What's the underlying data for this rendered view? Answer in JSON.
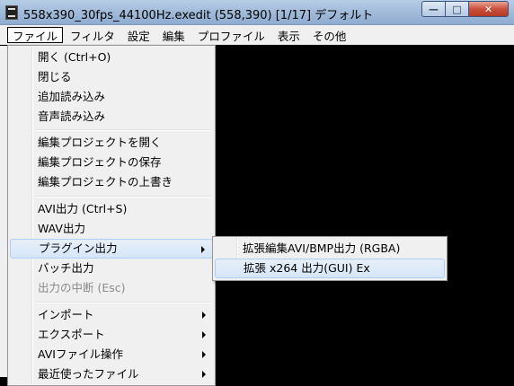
{
  "window": {
    "title": "558x390_30fps_44100Hz.exedit (558,390)  [1/17]  デフォルト",
    "minimize_glyph": "—",
    "maximize_glyph": "□",
    "close_glyph": "✕"
  },
  "menubar": {
    "items": [
      "ファイル",
      "フィルタ",
      "設定",
      "編集",
      "プロファイル",
      "表示",
      "その他"
    ]
  },
  "file_menu": {
    "items": [
      {
        "label": "開く (Ctrl+O)"
      },
      {
        "label": "閉じる"
      },
      {
        "label": "追加読み込み"
      },
      {
        "label": "音声読み込み"
      },
      {
        "label": "編集プロジェクトを開く"
      },
      {
        "label": "編集プロジェクトの保存"
      },
      {
        "label": "編集プロジェクトの上書き"
      },
      {
        "label": "AVI出力 (Ctrl+S)"
      },
      {
        "label": "WAV出力"
      },
      {
        "label": "プラグイン出力"
      },
      {
        "label": "バッチ出力"
      },
      {
        "label": "出力の中断 (Esc)"
      },
      {
        "label": "インポート"
      },
      {
        "label": "エクスポート"
      },
      {
        "label": "AVIファイル操作"
      },
      {
        "label": "最近使ったファイル"
      }
    ]
  },
  "plugin_submenu": {
    "items": [
      {
        "label": "拡張編集AVI/BMP出力 (RGBA)"
      },
      {
        "label": "拡張 x264 出力(GUI) Ex"
      }
    ]
  }
}
